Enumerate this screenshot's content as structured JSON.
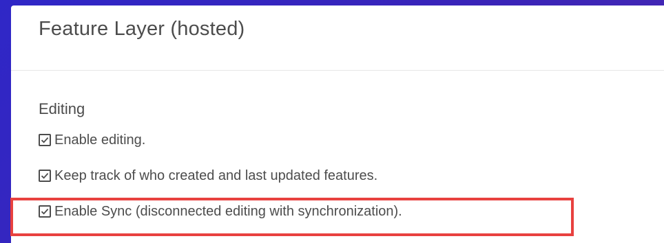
{
  "panel": {
    "title": "Feature Layer (hosted)"
  },
  "editing": {
    "heading": "Editing",
    "options": [
      {
        "label": "Enable editing.",
        "checked": true
      },
      {
        "label": "Keep track of who created and last updated features.",
        "checked": true
      },
      {
        "label": "Enable Sync (disconnected editing with synchronization).",
        "checked": true
      }
    ]
  },
  "colors": {
    "background": "#3a24b8",
    "text": "#4c4c4c",
    "highlight": "#e8413f"
  }
}
